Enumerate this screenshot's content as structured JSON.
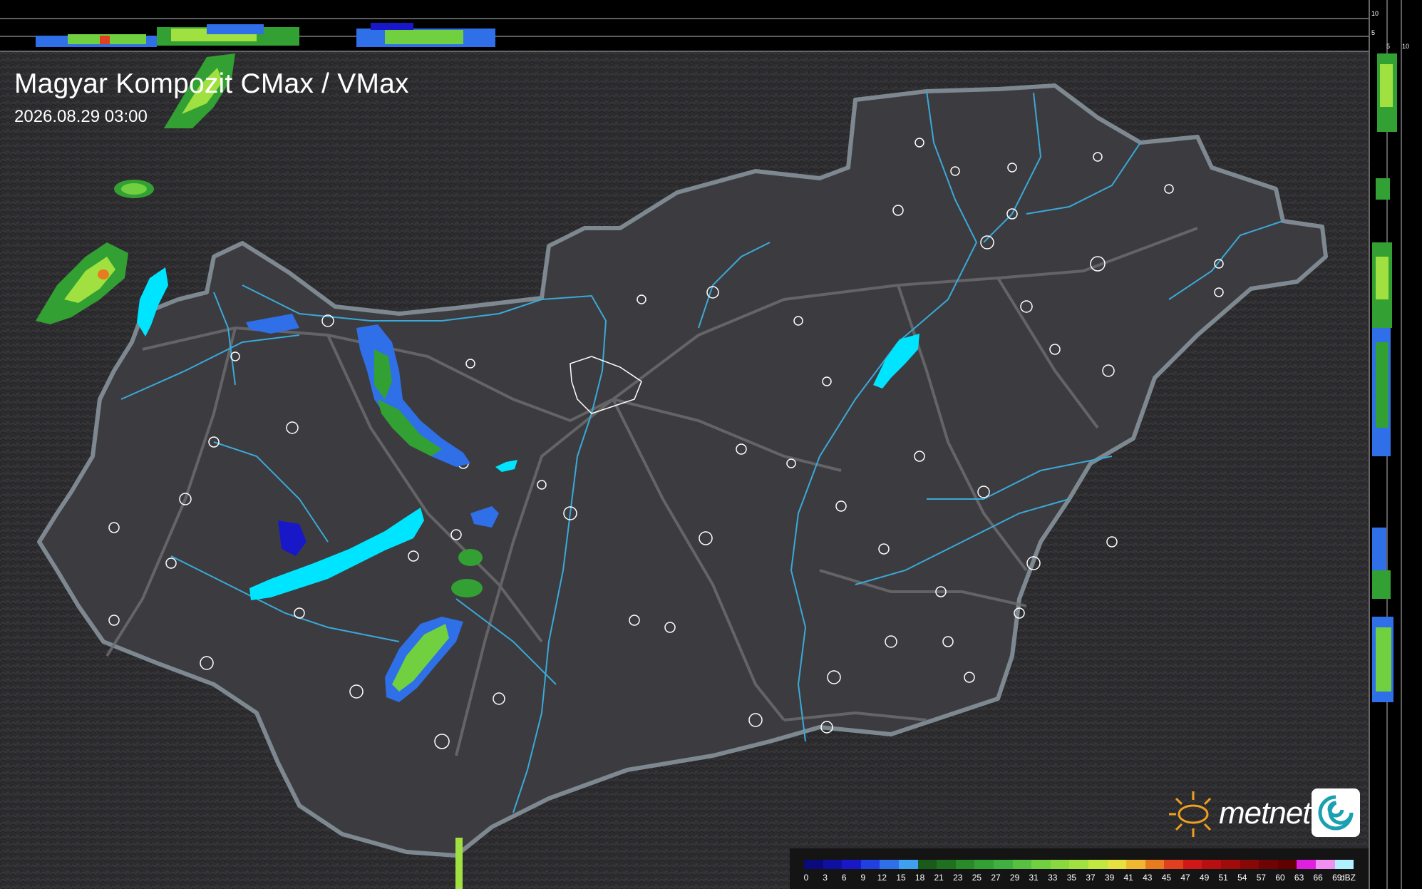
{
  "title": "Magyar Kompozit CMax / VMax",
  "timestamp": "2026.08.29 03:00",
  "brand": {
    "name": "metnet"
  },
  "top_scale": [
    "10",
    "5"
  ],
  "side_scale": [
    "5",
    "10"
  ],
  "legend": {
    "unit": "dBZ",
    "labels": [
      "0",
      "3",
      "6",
      "9",
      "12",
      "15",
      "18",
      "21",
      "23",
      "25",
      "27",
      "29",
      "31",
      "33",
      "35",
      "37",
      "39",
      "41",
      "43",
      "45",
      "47",
      "49",
      "51",
      "54",
      "57",
      "60",
      "63",
      "66",
      "69"
    ],
    "colors": [
      "#0a0a7a",
      "#1010a0",
      "#1818c8",
      "#2040e0",
      "#2f6fe8",
      "#3fa0f0",
      "#1a5a1a",
      "#1f701f",
      "#288a28",
      "#33a033",
      "#40b040",
      "#58c040",
      "#70d040",
      "#8ad840",
      "#a0e040",
      "#c0e840",
      "#e6e040",
      "#f0b830",
      "#e87a20",
      "#e04020",
      "#d01818",
      "#b81010",
      "#a00c0c",
      "#880808",
      "#700404",
      "#600000",
      "#e020e0",
      "#f090f0",
      "#b0f0ff"
    ]
  },
  "colors": {
    "background": "#2e2e30",
    "country_fill": "#3b3b3f",
    "border": "#7e8890",
    "rivers": "#3aa9d8",
    "lakes": "#00e5ff",
    "roads": "#6c6c6e",
    "cities": "#ffffff"
  },
  "icons": {
    "logo_sun": "sun-logo-icon",
    "logo_swirl": "swirl-logo-icon"
  }
}
